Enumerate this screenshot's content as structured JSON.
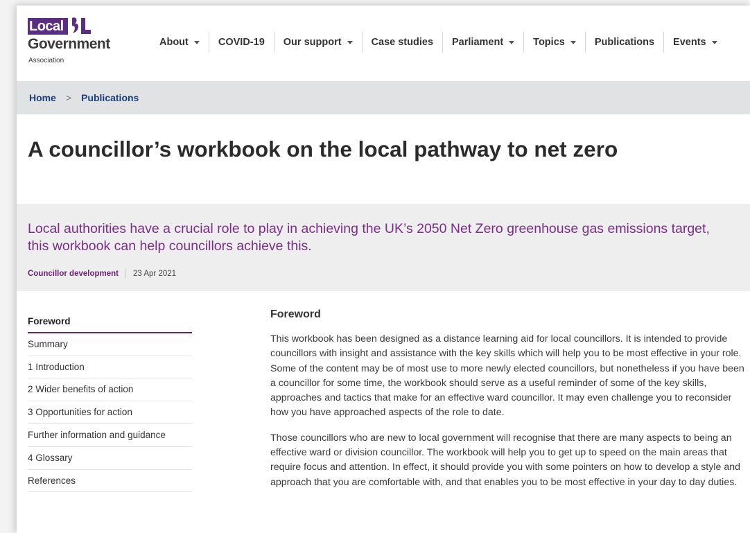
{
  "brand": {
    "logo_local": "Local",
    "logo_government": "Government",
    "logo_association": "Association",
    "color_primary": "#5c2d82"
  },
  "nav": {
    "items": [
      {
        "label": "About",
        "has_dropdown": true
      },
      {
        "label": "COVID-19",
        "has_dropdown": false
      },
      {
        "label": "Our support",
        "has_dropdown": true
      },
      {
        "label": "Case studies",
        "has_dropdown": false
      },
      {
        "label": "Parliament",
        "has_dropdown": true
      },
      {
        "label": "Topics",
        "has_dropdown": true
      },
      {
        "label": "Publications",
        "has_dropdown": false
      },
      {
        "label": "Events",
        "has_dropdown": true
      }
    ]
  },
  "breadcrumb": {
    "home": "Home",
    "separator": ">",
    "current": "Publications"
  },
  "page": {
    "title": "A councillor’s workbook on the local pathway to net zero",
    "summary": "Local authorities have a crucial role to play in achieving the UK’s 2050 Net Zero greenhouse gas emissions target, this workbook can help councillors achieve this.",
    "tag": "Councillor development",
    "date": "23 Apr 2021"
  },
  "toc": {
    "items": [
      "Foreword",
      "Summary",
      "1 Introduction",
      "2 Wider benefits of action",
      "3 Opportunities for action",
      "Further information and guidance",
      "4 Glossary",
      "References"
    ],
    "active_index": 0
  },
  "content": {
    "heading": "Foreword",
    "paragraphs": [
      "This workbook has been designed as a distance learning aid for local councillors. It is intended to provide councillors with insight and assistance with the key skills which will help you to be most effective in your role. Some of the content may be of most use to more newly elected councillors, but nonetheless if you have been a councillor for some time, the workbook should serve as a useful reminder of some of the key skills, approaches and tactics that make for an effective ward councillor. It may even challenge you to reconsider how you have approached aspects of the role to date.",
      "Those councillors who are new to local government will recognise that there are many aspects to being an effective ward or division councillor. The workbook will help you to get up to speed on the main areas that require focus and attention. In effect, it should provide you with some pointers on how to develop a style and approach that you are comfortable with, and that enables you to be most effective in your day to day duties."
    ]
  }
}
